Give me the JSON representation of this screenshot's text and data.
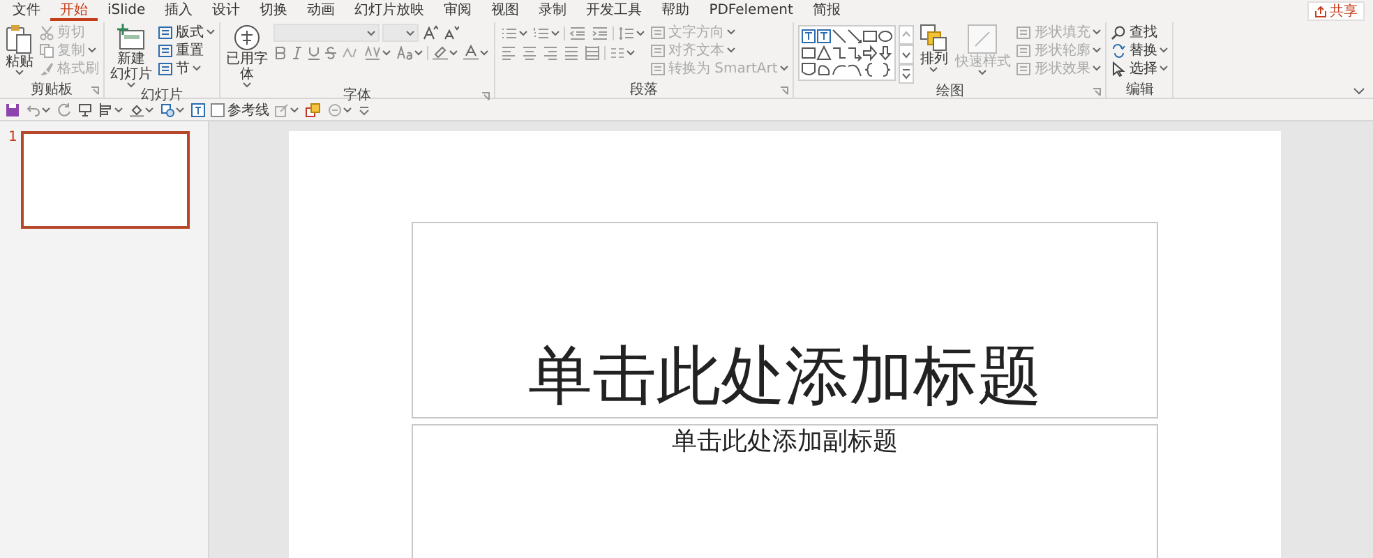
{
  "tabs": [
    {
      "label": "文件",
      "selected": false
    },
    {
      "label": "开始",
      "selected": true
    },
    {
      "label": "iSlide",
      "selected": false
    },
    {
      "label": "插入",
      "selected": false
    },
    {
      "label": "设计",
      "selected": false
    },
    {
      "label": "切换",
      "selected": false
    },
    {
      "label": "动画",
      "selected": false
    },
    {
      "label": "幻灯片放映",
      "selected": false
    },
    {
      "label": "审阅",
      "selected": false
    },
    {
      "label": "视图",
      "selected": false
    },
    {
      "label": "录制",
      "selected": false
    },
    {
      "label": "开发工具",
      "selected": false
    },
    {
      "label": "帮助",
      "selected": false
    },
    {
      "label": "PDFelement",
      "selected": false
    },
    {
      "label": "简报",
      "selected": false
    }
  ],
  "share_button": {
    "label": "共享"
  },
  "ribbon": {
    "groups": [
      {
        "label": "剪贴板",
        "launcher": true,
        "columns": [
          {
            "kind": "large",
            "lines": [
              "粘贴"
            ],
            "dropdown": true,
            "disabled": false
          },
          {
            "kind": "stack",
            "items": [
              {
                "label": "剪切",
                "disabled": true,
                "dropdown": false
              },
              {
                "label": "复制",
                "disabled": true,
                "dropdown": true
              },
              {
                "label": "格式刷",
                "disabled": true,
                "dropdown": false
              }
            ]
          }
        ]
      },
      {
        "label": "幻灯片",
        "launcher": false,
        "columns": [
          {
            "kind": "large",
            "lines": [
              "新建",
              "幻灯片"
            ],
            "dropdown": true,
            "disabled": false
          },
          {
            "kind": "stack",
            "items": [
              {
                "label": "版式",
                "disabled": false,
                "dropdown": true
              },
              {
                "label": "重置",
                "disabled": false,
                "dropdown": false
              },
              {
                "label": "节",
                "disabled": false,
                "dropdown": true
              }
            ]
          }
        ]
      },
      {
        "label": "字体",
        "launcher": true,
        "columns": [
          {
            "kind": "large",
            "lines": [
              "已用字",
              "体"
            ],
            "dropdown": true,
            "disabled": false
          },
          {
            "kind": "font"
          }
        ]
      },
      {
        "label": "段落",
        "launcher": true,
        "columns": [
          {
            "kind": "paragraph"
          },
          {
            "kind": "stack",
            "items": [
              {
                "label": "文字方向",
                "disabled": true,
                "dropdown": true
              },
              {
                "label": "对齐文本",
                "disabled": true,
                "dropdown": true
              },
              {
                "label": "转换为 SmartArt",
                "disabled": true,
                "dropdown": true
              }
            ]
          }
        ]
      },
      {
        "label": "绘图",
        "launcher": true,
        "columns": [
          {
            "kind": "shapes"
          },
          {
            "kind": "large",
            "lines": [
              "排列"
            ],
            "dropdown": true,
            "disabled": false
          },
          {
            "kind": "large",
            "lines": [
              "快速样式"
            ],
            "dropdown": true,
            "disabled": true
          },
          {
            "kind": "stack",
            "items": [
              {
                "label": "形状填充",
                "disabled": true,
                "dropdown": true
              },
              {
                "label": "形状轮廓",
                "disabled": true,
                "dropdown": true
              },
              {
                "label": "形状效果",
                "disabled": true,
                "dropdown": true
              }
            ]
          }
        ]
      },
      {
        "label": "编辑",
        "launcher": false,
        "columns": [
          {
            "kind": "stack",
            "items": [
              {
                "label": "查找",
                "disabled": false,
                "dropdown": false
              },
              {
                "label": "替换",
                "disabled": false,
                "dropdown": true
              },
              {
                "label": "选择",
                "disabled": false,
                "dropdown": true
              }
            ]
          }
        ]
      }
    ]
  },
  "quick_access": {
    "guides_checkbox": {
      "label": "参考线",
      "checked": false
    }
  },
  "slides": [
    {
      "number": "1",
      "selected": true
    }
  ],
  "slide": {
    "title_placeholder": "单击此处添加标题",
    "subtitle_placeholder": "单击此处添加副标题"
  }
}
